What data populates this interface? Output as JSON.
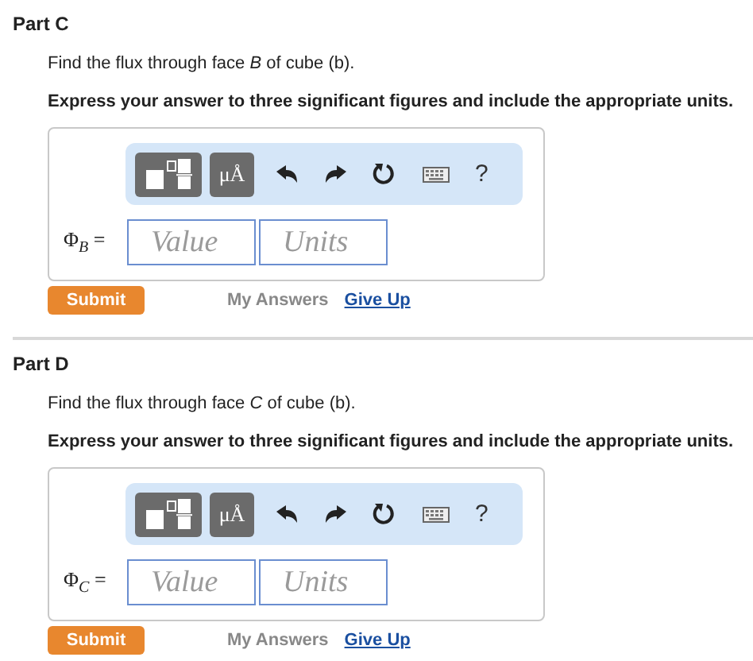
{
  "parts": [
    {
      "title": "Part C",
      "prompt": "Find the flux through face *B* of cube (b).",
      "instruction": "Express your answer to three significant figures and include the appropriate units.",
      "toolbar": {
        "units_button": "μÅ",
        "help_button": "?"
      },
      "answer": {
        "label": "Φ$_{B}$ =",
        "value_placeholder": "Value",
        "units_placeholder": "Units"
      },
      "submit": "Submit",
      "my_answers": "My Answers",
      "give_up": "Give Up"
    },
    {
      "title": "Part D",
      "prompt": "Find the flux through face *C* of cube (b).",
      "instruction": "Express your answer to three significant figures and include the appropriate units.",
      "toolbar": {
        "units_button": "μÅ",
        "help_button": "?"
      },
      "answer": {
        "label": "Φ$_{C}$ =",
        "value_placeholder": "Value",
        "units_placeholder": "Units"
      },
      "submit": "Submit",
      "my_answers": "My Answers",
      "give_up": "Give Up"
    }
  ]
}
